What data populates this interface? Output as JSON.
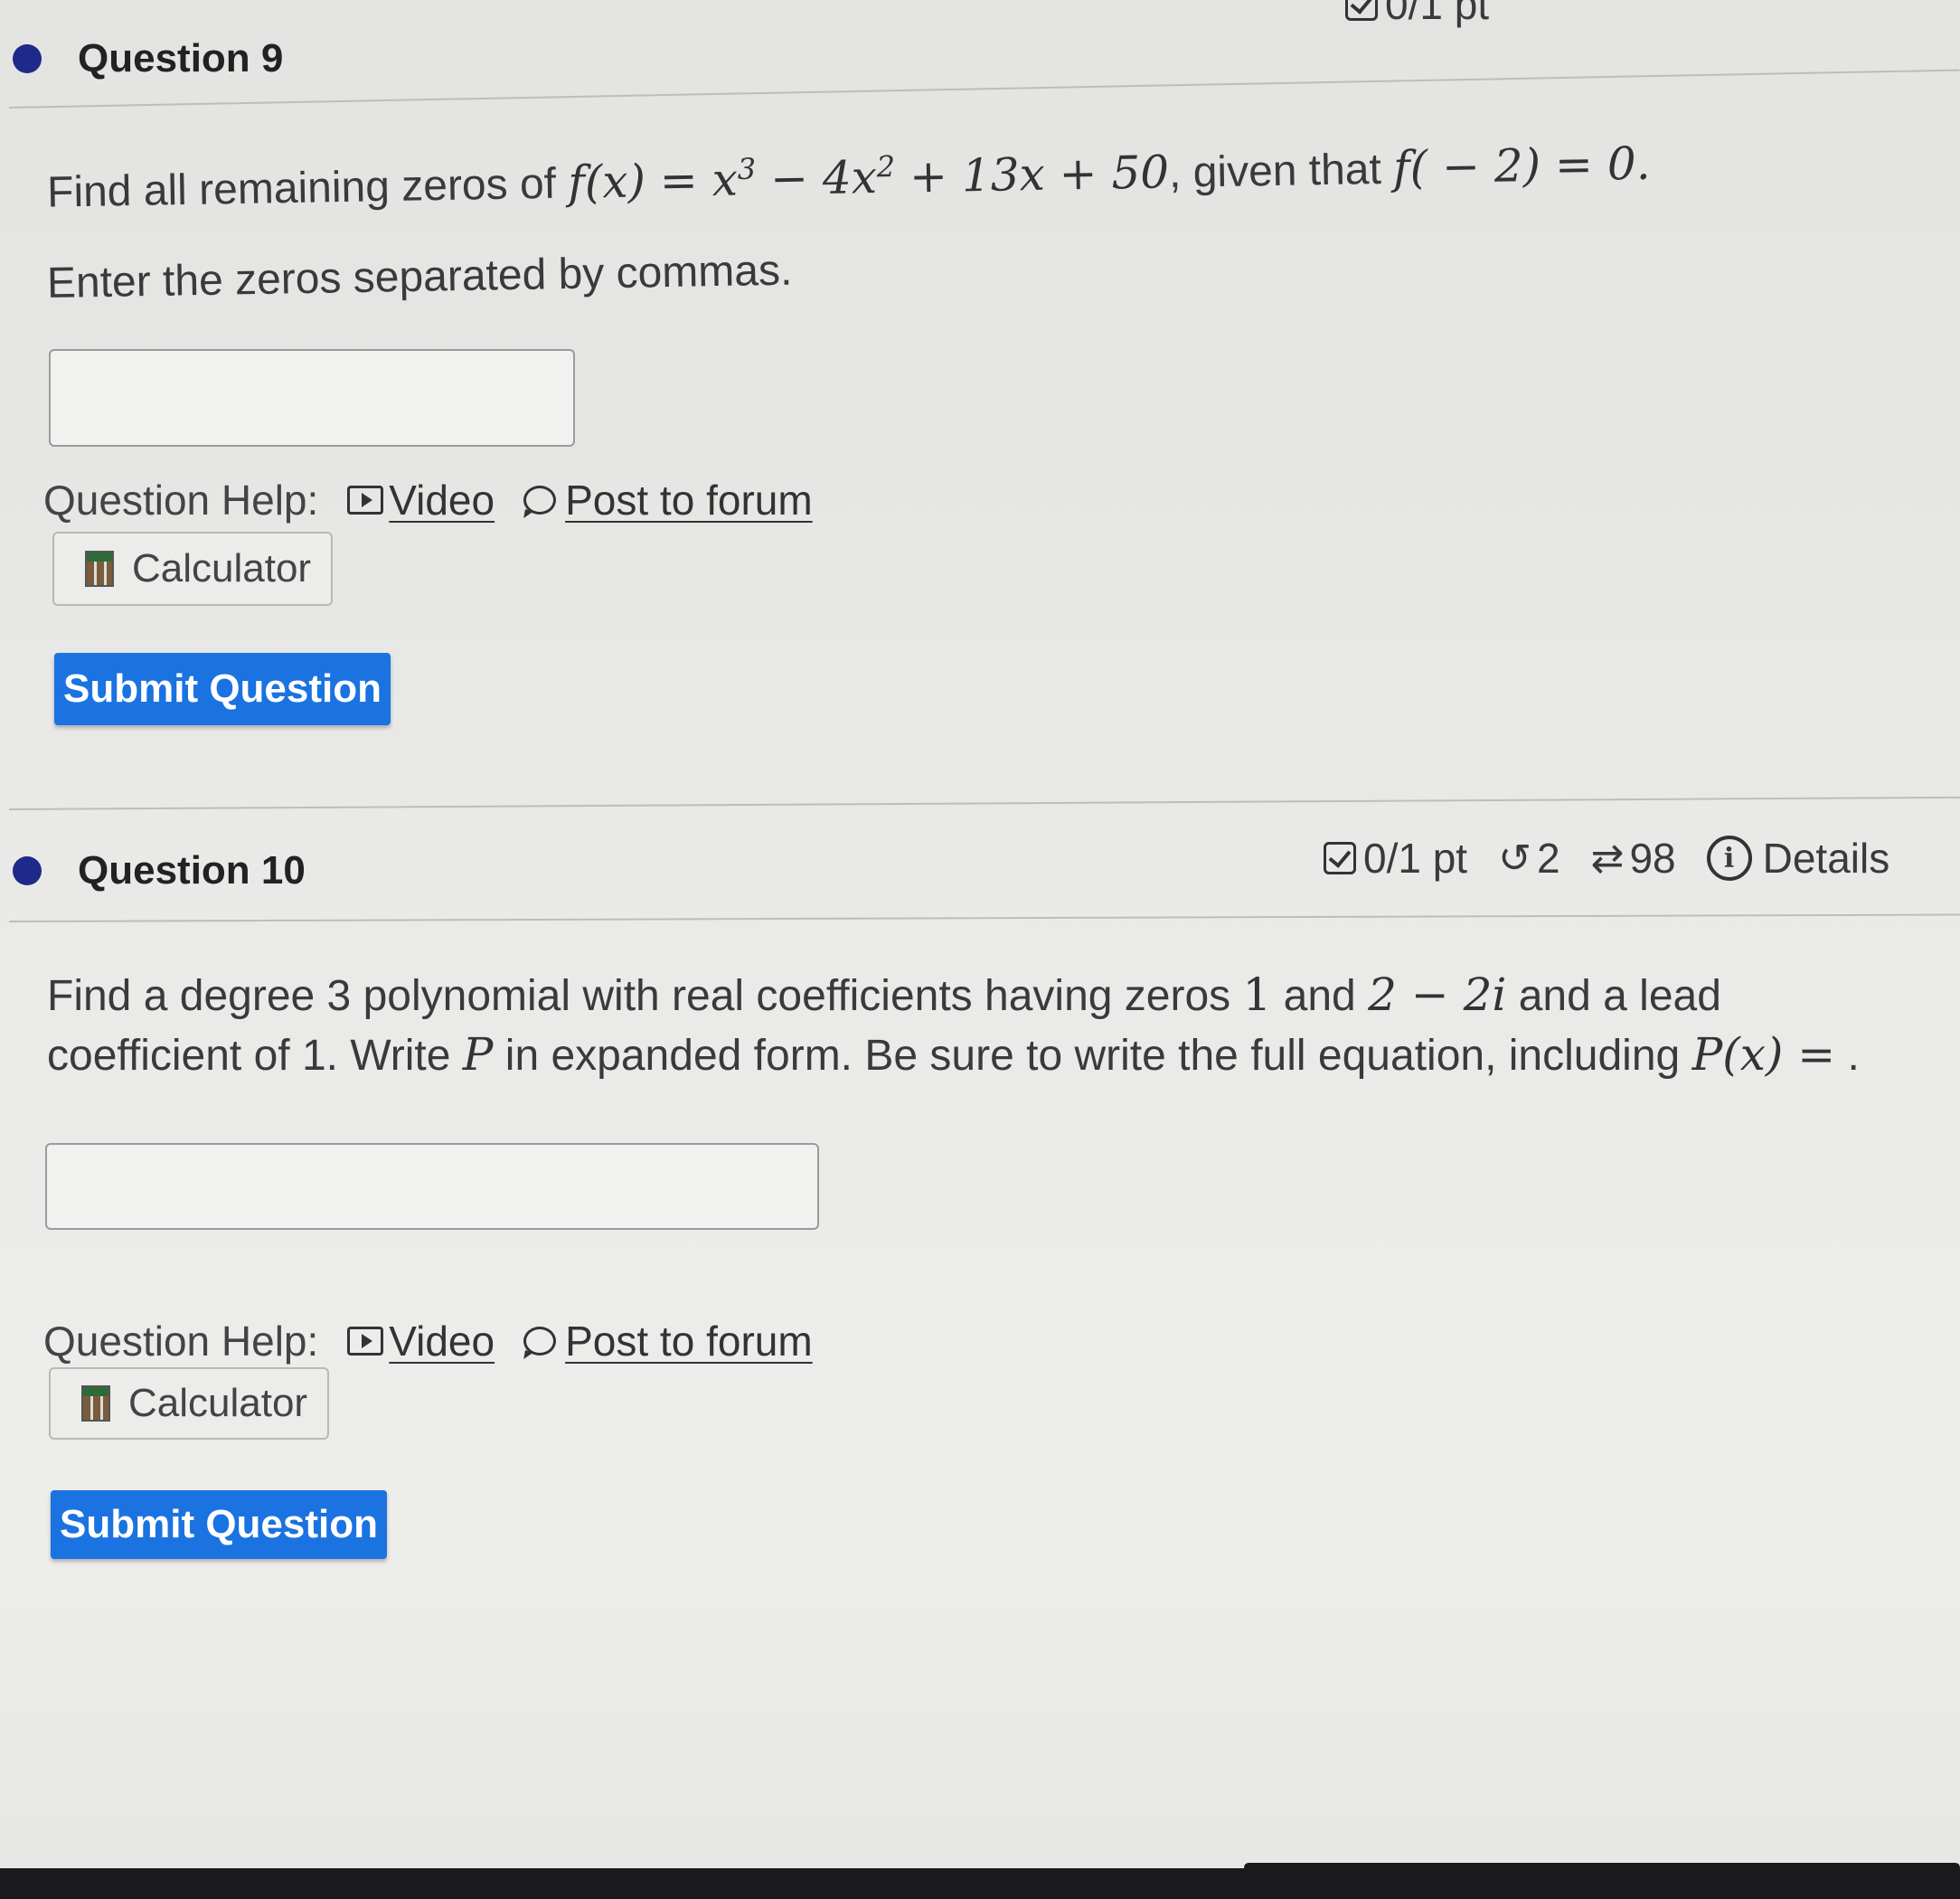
{
  "q9": {
    "title": "Question 9",
    "meta_partial": "0/1 pt",
    "prompt_pre": "Find all remaining zeros of ",
    "prompt_func": "f(x) = x",
    "prompt_rest1": " − 4x",
    "prompt_rest2": " + 13x + 50",
    "prompt_mid": ", given that ",
    "prompt_cond": "f( − 2) = 0.",
    "exp3": "3",
    "exp2": "2",
    "instruction": "Enter the zeros separated by commas.",
    "answer_value": "",
    "help_label": "Question Help:",
    "video_label": "Video",
    "forum_label": "Post to forum",
    "calculator_label": "Calculator",
    "submit_label": "Submit Question"
  },
  "q10": {
    "title": "Question 10",
    "points": "0/1 pt",
    "retries": "2",
    "attempts": "98",
    "details": "Details",
    "prompt_a": "Find a degree 3 polynomial with real coefficients having zeros ",
    "zero1": "1",
    "and": " and ",
    "zero2": "2 − 2i",
    "prompt_b": " and a lead coefficient of 1. Write ",
    "var_p": "P",
    "prompt_c": " in expanded form. Be sure to write the full equation, including ",
    "eq": "P(x) =",
    "prompt_end": " .",
    "answer_value": "",
    "help_label": "Question Help:",
    "video_label": "Video",
    "forum_label": "Post to forum",
    "calculator_label": "Calculator",
    "submit_label": "Submit Question"
  },
  "colors": {
    "accent": "#1a73e0",
    "dot": "#1d2a8a"
  }
}
